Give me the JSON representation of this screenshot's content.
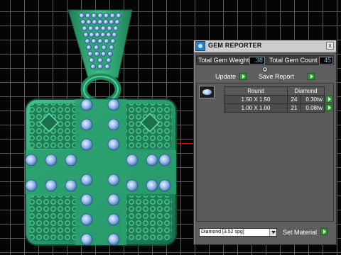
{
  "panel": {
    "title": "GEM REPORTER",
    "close_label": "x",
    "total_gem_weight_label": "Total Gem Weight",
    "total_gem_weight_value": ".38",
    "total_gem_count_label": "Total Gem Count",
    "total_gem_count_value": "45",
    "update_label": "Update",
    "save_report_label": "Save Report",
    "table": {
      "headers": [
        "Round",
        "Diamond"
      ],
      "rows": [
        {
          "size": "1.50 X 1.50",
          "count": "24",
          "weight": "0.30tw"
        },
        {
          "size": "1.00 X 1.00",
          "count": "21",
          "weight": "0.08tw"
        }
      ]
    },
    "material_selected": "Diamond    [3.52 spg]",
    "set_material_label": "Set Material"
  },
  "colors": {
    "metal": "#2e9d6e",
    "gem": "#a9c8f0",
    "accent_go": "#2f9a2f",
    "value_text": "#5fd0ff"
  }
}
